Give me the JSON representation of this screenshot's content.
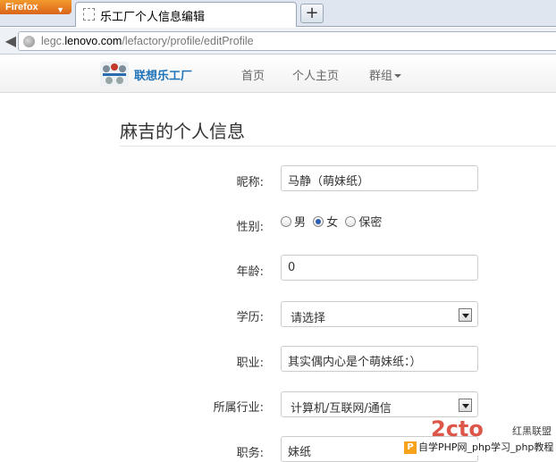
{
  "browser": {
    "menu_button": "Firefox",
    "tab_title": "乐工厂个人信息编辑",
    "new_tab": "+",
    "url_prefix": "legc.",
    "url_domain": "lenovo.com",
    "url_path": "/lefactory/profile/editProfile"
  },
  "site": {
    "logo_text": "联想乐工厂",
    "nav": [
      "首页",
      "个人主页",
      "群组"
    ]
  },
  "page": {
    "title": "麻吉的个人信息"
  },
  "form": {
    "nickname_label": "昵称:",
    "nickname_value": "马静（萌妹纸）",
    "gender_label": "性别:",
    "gender_options": [
      "男",
      "女",
      "保密"
    ],
    "gender_selected": "女",
    "age_label": "年龄:",
    "age_value": "0",
    "education_label": "学历:",
    "education_value": "请选择",
    "occupation_label": "职业:",
    "occupation_value": "其实偶内心是个萌妹纸：）",
    "industry_label": "所属行业:",
    "industry_value": "计算机/互联网/通信",
    "position_label": "职务:",
    "position_value": "妹纸"
  },
  "watermark": {
    "brand": "红黑联盟",
    "banner": "自学PHP网_php学习_php教程"
  }
}
